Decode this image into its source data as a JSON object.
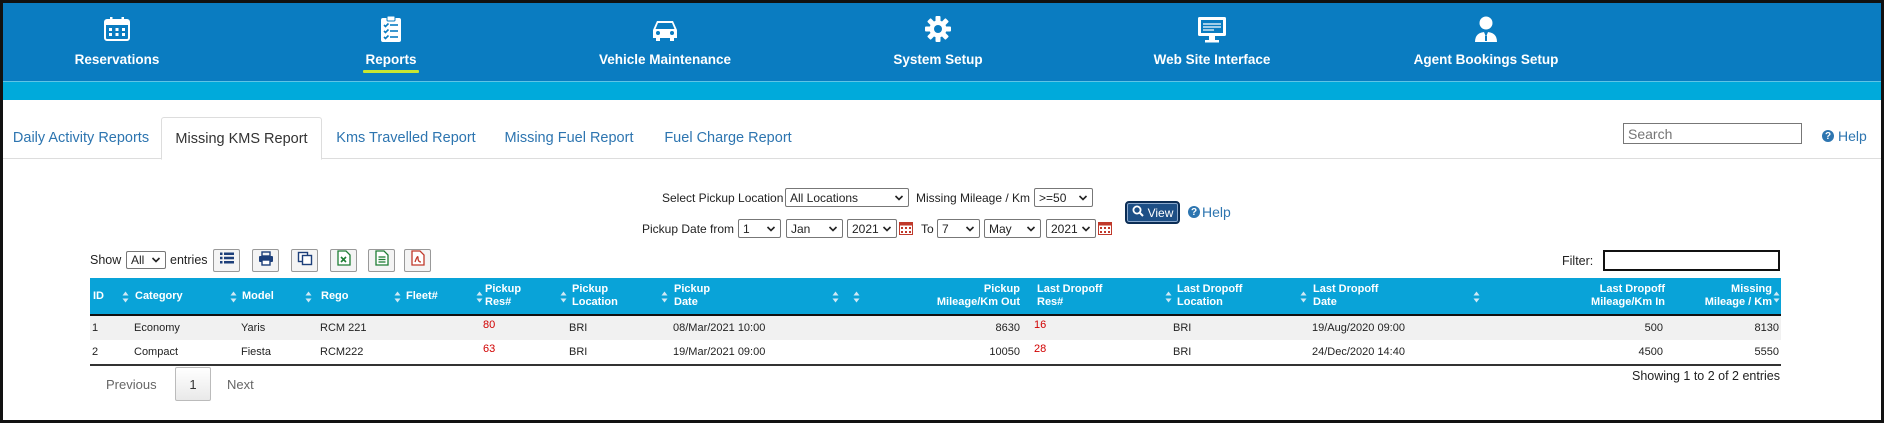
{
  "nav": {
    "items": [
      {
        "label": "Reservations",
        "icon": "calendar-icon"
      },
      {
        "label": "Reports",
        "icon": "clipboard-checklist-icon",
        "active": true
      },
      {
        "label": "Vehicle Maintenance",
        "icon": "car-icon"
      },
      {
        "label": "System Setup",
        "icon": "gear-icon"
      },
      {
        "label": "Web Site Interface",
        "icon": "monitor-icon"
      },
      {
        "label": "Agent Bookings Setup",
        "icon": "agent-user-icon"
      }
    ],
    "colors": {
      "background": "#0a7cc1",
      "subbar": "#00aadb",
      "active_underline": "#c8e632"
    }
  },
  "tabs": [
    {
      "label": "Daily Activity Reports"
    },
    {
      "label": "Missing KMS Report",
      "active": true
    },
    {
      "label": "Kms Travelled Report"
    },
    {
      "label": "Missing Fuel Report"
    },
    {
      "label": "Fuel Charge Report"
    }
  ],
  "search": {
    "placeholder": "Search",
    "value": ""
  },
  "help_label": "Help",
  "filters": {
    "pickup_location_label": "Select Pickup Location",
    "pickup_location_value": "All Locations",
    "missing_mileage_label": "Missing Mileage / Km",
    "missing_mileage_value": ">=50",
    "pickup_date_from_label": "Pickup Date from",
    "from_day": "1",
    "from_month": "Jan",
    "from_year": "2021",
    "to_label": "To",
    "to_day": "7",
    "to_month": "May",
    "to_year": "2021",
    "view_label": "View",
    "help_label": "Help"
  },
  "table_controls": {
    "show_label": "Show",
    "show_value": "All",
    "entries_label": "entries",
    "tools": [
      "list-view-icon",
      "print-icon",
      "copy-icon",
      "excel-icon",
      "csv-icon",
      "pdf-icon"
    ],
    "filter_label": "Filter:",
    "filter_value": ""
  },
  "table": {
    "header_color": "#09a3d8",
    "columns": [
      {
        "label": "ID"
      },
      {
        "label": "Category"
      },
      {
        "label": "Model"
      },
      {
        "label": "Rego"
      },
      {
        "label": "Fleet#"
      },
      {
        "label": "Pickup\nRes#"
      },
      {
        "label": "Pickup\nLocation"
      },
      {
        "label": "Pickup\nDate"
      },
      {
        "label": ""
      },
      {
        "label": "Pickup\nMileage/Km Out"
      },
      {
        "label": "Last Dropoff\nRes#"
      },
      {
        "label": "Last Dropoff\nLocation"
      },
      {
        "label": "Last Dropoff\nDate"
      },
      {
        "label": "Last Dropoff\nMileage/Km In"
      },
      {
        "label": "Missing\nMileage / Km"
      }
    ],
    "rows": [
      {
        "id": "1",
        "category": "Economy",
        "model": "Yaris",
        "rego": "RCM 221",
        "fleet": "",
        "pickup_res": "80",
        "pickup_location": "BRI",
        "pickup_date": "08/Mar/2021 10:00",
        "pickup_mileage": "8630",
        "dropoff_res": "16",
        "dropoff_location": "BRI",
        "dropoff_date": "19/Aug/2020 09:00",
        "dropoff_mileage": "500",
        "missing": "8130"
      },
      {
        "id": "2",
        "category": "Compact",
        "model": "Fiesta",
        "rego": "RCM222",
        "fleet": "",
        "pickup_res": "63",
        "pickup_location": "BRI",
        "pickup_date": "19/Mar/2021 09:00",
        "pickup_mileage": "10050",
        "dropoff_res": "28",
        "dropoff_location": "BRI",
        "dropoff_date": "24/Dec/2020 14:40",
        "dropoff_mileage": "4500",
        "missing": "5550"
      }
    ]
  },
  "pagination": {
    "previous_label": "Previous",
    "current_page": "1",
    "next_label": "Next",
    "info": "Showing 1 to 2 of 2 entries"
  }
}
